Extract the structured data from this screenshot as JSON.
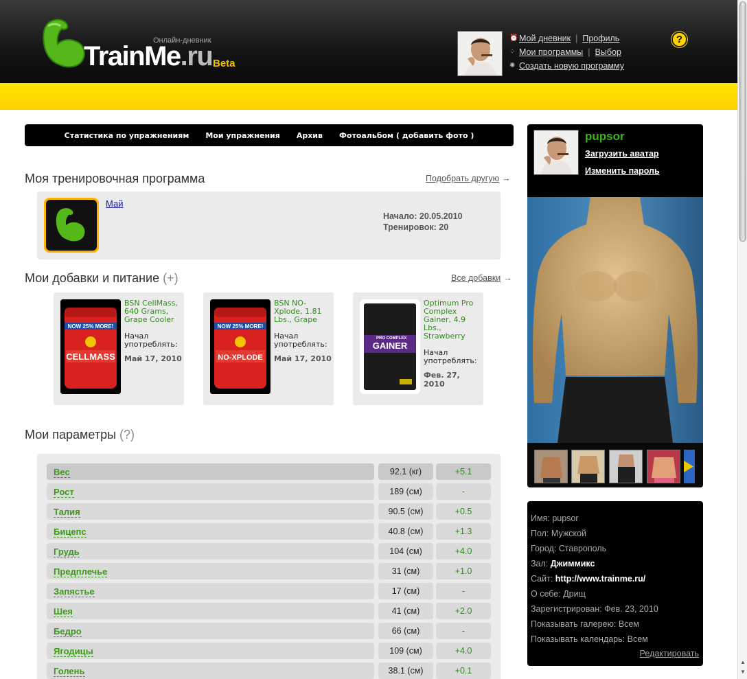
{
  "header": {
    "brand_main": "TrainMe",
    "brand_ru": ".ru",
    "beta": "Beta",
    "tagline": "Онлайн-дневник",
    "links": {
      "diary": "Мой дневник",
      "profile": "Профиль",
      "programs": "Мои программы",
      "choice": "Выбор",
      "create": "Создать новую программу",
      "sep": "|"
    },
    "help": "?"
  },
  "nav": {
    "items": [
      "Статистика по упражнениям",
      "Мои упражнения",
      "Архив",
      "Фотоальбом ( добавить фото )"
    ]
  },
  "program": {
    "title": "Моя тренировочная программа",
    "other_link": "Подобрать другую",
    "arrow": "→",
    "name": "Май",
    "start": "Начало: 20.05.2010",
    "count": "Тренировок: 20"
  },
  "supplements": {
    "title": "Мои добавки и питание",
    "plus": "(+)",
    "all_link": "Все добавки",
    "items": [
      {
        "name": "BSN CellMass, 640 Grams, Grape Cooler",
        "started": "Начал употреблять:",
        "date": "Май 17, 2010",
        "banner": "NOW 25% MORE!",
        "label": "CELLMASS"
      },
      {
        "name": "BSN NO-Xplode, 1.81 Lbs., Grape",
        "started": "Начал употреблять:",
        "date": "Май 17, 2010",
        "banner": "NOW 25% MORE!",
        "label": "NO-XPLODE"
      },
      {
        "name": "Optimum Pro Complex Gainer, 4.9 Lbs., Strawberry",
        "started": "Начал употреблять:",
        "date": "Фев. 27, 2010",
        "banner": "PRO COMPLEX",
        "label": "GAINER"
      }
    ]
  },
  "params": {
    "title": "Мои параметры",
    "help": "(?)",
    "rows": [
      {
        "name": "Вес",
        "value": "92.1 (кг)",
        "delta": "+5.1"
      },
      {
        "name": "Рост",
        "value": "189 (см)",
        "delta": "-"
      },
      {
        "name": "Талия",
        "value": "90.5 (см)",
        "delta": "+0.5"
      },
      {
        "name": "Бицепс",
        "value": "40.8 (см)",
        "delta": "+1.3"
      },
      {
        "name": "Грудь",
        "value": "104 (см)",
        "delta": "+4.0"
      },
      {
        "name": "Предплечье",
        "value": "31 (см)",
        "delta": "+1.0"
      },
      {
        "name": "Запястье",
        "value": "17 (см)",
        "delta": "-"
      },
      {
        "name": "Шея",
        "value": "41 (см)",
        "delta": "+2.0"
      },
      {
        "name": "Бедро",
        "value": "66 (см)",
        "delta": "-"
      },
      {
        "name": "Ягодицы",
        "value": "109 (см)",
        "delta": "+4.0"
      },
      {
        "name": "Голень",
        "value": "38.1 (см)",
        "delta": "+0.1"
      }
    ]
  },
  "profile": {
    "username": "pupsor",
    "upload_avatar": "Загрузить аватар",
    "change_password": "Изменить пароль"
  },
  "info": {
    "name": {
      "label": "Имя:",
      "value": "pupsor"
    },
    "gender": {
      "label": "Пол:",
      "value": "Мужской"
    },
    "city": {
      "label": "Город:",
      "value": "Ставрополь"
    },
    "gym": {
      "label": "Зал:",
      "value": "Джиммикс"
    },
    "site": {
      "label": "Сайт:",
      "value": "http://www.trainme.ru/"
    },
    "about": {
      "label": "О себе:",
      "value": "Дрищ"
    },
    "registered": {
      "label": "Зарегистрирован:",
      "value": "Фев. 23, 2010"
    },
    "show_gallery": {
      "label": "Показывать галерею:",
      "value": "Всем"
    },
    "show_calendar": {
      "label": "Показывать календарь:",
      "value": "Всем"
    },
    "edit": "Редактировать"
  }
}
